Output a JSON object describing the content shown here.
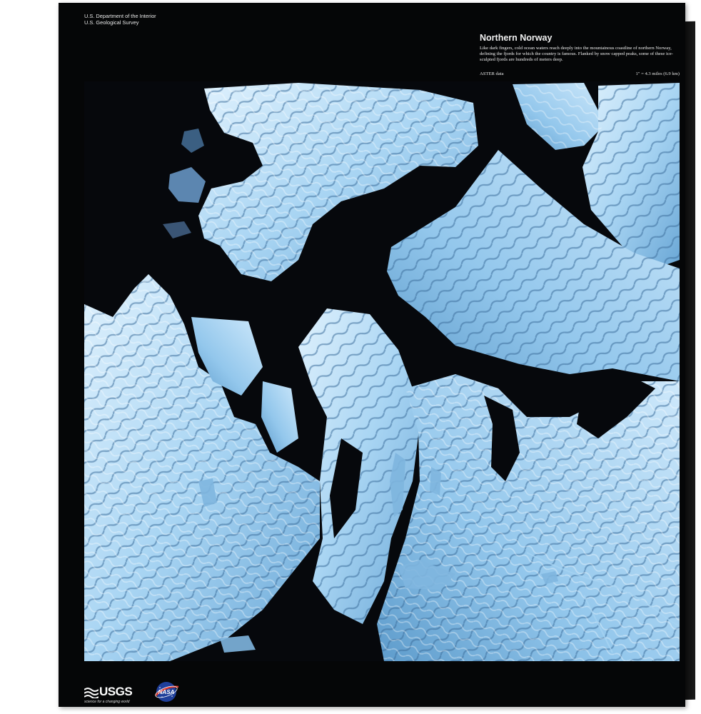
{
  "agency": {
    "line1": "U.S. Department of the Interior",
    "line2": "U.S. Geological Survey"
  },
  "info": {
    "title": "Northern Norway",
    "description": "Like dark fingers, cold ocean waters reach deeply into the mountainous coastline of northern Norway, defining the fjords for which the country is famous. Flanked by snow capped peaks, some of these ice-sculpted fjords are hundreds of meters deep.",
    "data_source": "ASTER data",
    "scale": "1\" = 4.3 miles (6.9 km)"
  },
  "logos": {
    "usgs_text": "USGS",
    "usgs_tagline": "science for a changing world",
    "nasa_text": "NASA"
  },
  "colors": {
    "canvas": "#050607",
    "water": "#06080c",
    "snow_light": "#cfe8fb",
    "snow_mid": "#8fc4ea",
    "shadow_blue": "#3c6f9e"
  },
  "icons": [
    "usgs-logo-icon",
    "nasa-meatball-icon"
  ]
}
